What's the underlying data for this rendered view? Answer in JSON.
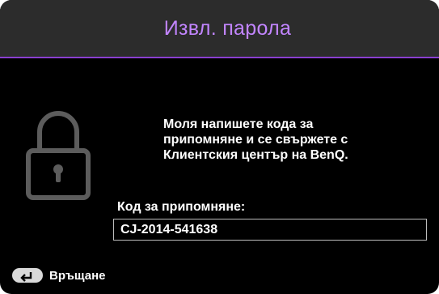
{
  "dialog": {
    "title": "Извл. парола",
    "message_lines": [
      "Моля напишете кода за",
      "припомняне и се свържете с",
      "Клиентския център на BenQ."
    ],
    "recall_code_label": "Код за припомняне:",
    "recall_code_value": "CJ-2014-541638"
  },
  "footer": {
    "return_icon": "return-arrow-icon",
    "return_label": "Връщане"
  },
  "icons": {
    "main": "padlock-icon"
  },
  "colors": {
    "title_text": "#c285ff",
    "title_accent_line": "#8a3fd0",
    "background": "#000000",
    "title_bar": "#2c2c2c",
    "lock_icon": "#5c5c5c"
  }
}
